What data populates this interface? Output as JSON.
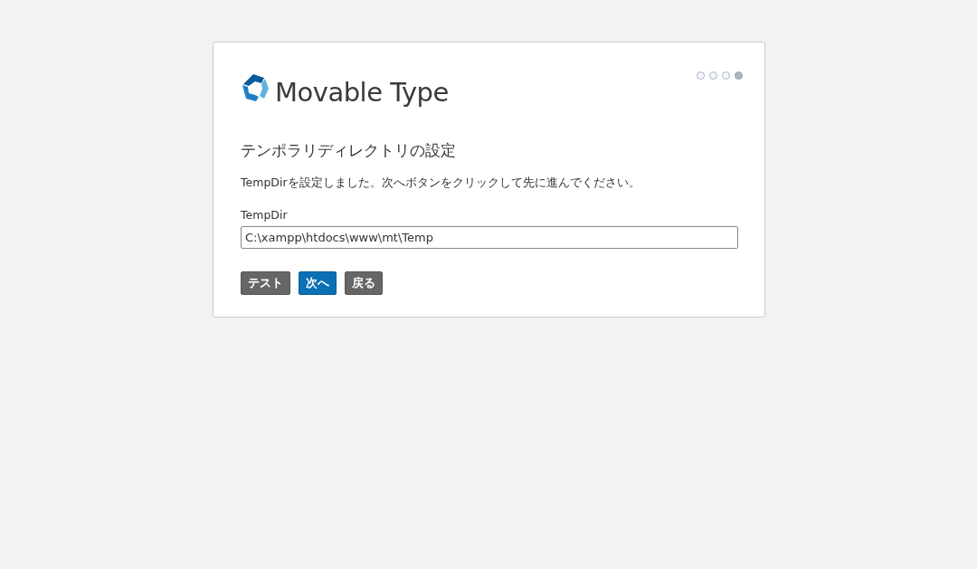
{
  "logo": {
    "text": "Movable Type"
  },
  "steps": [
    {
      "selected": false
    },
    {
      "selected": false
    },
    {
      "selected": false
    },
    {
      "selected": true
    }
  ],
  "heading": "テンポラリディレクトリの設定",
  "message": "TempDirを設定しました。次へボタンをクリックして先に進んでください。",
  "field": {
    "label": "TempDir",
    "value": "C:\\xampp\\htdocs\\www\\mt\\Temp"
  },
  "buttons": [
    {
      "label": "テスト",
      "kind": "secondary"
    },
    {
      "label": "次へ",
      "kind": "primary"
    },
    {
      "label": "戻る",
      "kind": "secondary"
    }
  ]
}
